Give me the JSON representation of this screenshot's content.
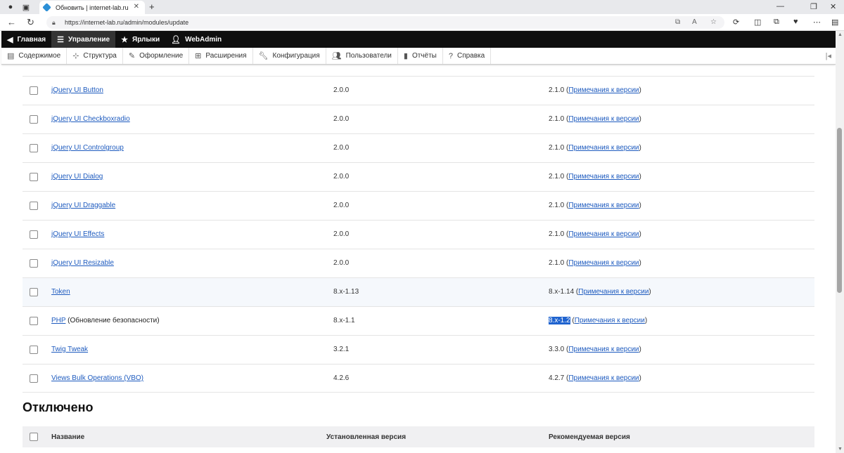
{
  "browser": {
    "tab_title": "Обновить | internet-lab.ru",
    "url": "https://internet-lab.ru/admin/modules/update"
  },
  "toolbar": {
    "items": [
      {
        "label": "Главная",
        "icon": "back-arrow-icon"
      },
      {
        "label": "Управление",
        "icon": "hamburger-icon"
      },
      {
        "label": "Ярлыки",
        "icon": "star-icon"
      },
      {
        "label": "WebAdmin",
        "icon": "user-icon"
      }
    ]
  },
  "tray": {
    "items": [
      {
        "label": "Содержимое",
        "icon": "content-icon"
      },
      {
        "label": "Структура",
        "icon": "structure-icon"
      },
      {
        "label": "Оформление",
        "icon": "appearance-icon"
      },
      {
        "label": "Расширения",
        "icon": "extend-icon"
      },
      {
        "label": "Конфигурация",
        "icon": "wrench-icon"
      },
      {
        "label": "Пользователи",
        "icon": "people-icon"
      },
      {
        "label": "Отчёты",
        "icon": "reports-icon"
      },
      {
        "label": "Справка",
        "icon": "help-icon"
      }
    ]
  },
  "updates": {
    "release_notes_label": "Примечания к версии",
    "rows": [
      {
        "name": "jQuery UI Button",
        "suffix": "",
        "installed": "2.0.0",
        "recommended": "2.1.0"
      },
      {
        "name": "jQuery UI Checkboxradio",
        "suffix": "",
        "installed": "2.0.0",
        "recommended": "2.1.0"
      },
      {
        "name": "jQuery UI Controlgroup",
        "suffix": "",
        "installed": "2.0.0",
        "recommended": "2.1.0"
      },
      {
        "name": "jQuery UI Dialog",
        "suffix": "",
        "installed": "2.0.0",
        "recommended": "2.1.0"
      },
      {
        "name": "jQuery UI Draggable",
        "suffix": "",
        "installed": "2.0.0",
        "recommended": "2.1.0"
      },
      {
        "name": "jQuery UI Effects",
        "suffix": "",
        "installed": "2.0.0",
        "recommended": "2.1.0"
      },
      {
        "name": "jQuery UI Resizable",
        "suffix": "",
        "installed": "2.0.0",
        "recommended": "2.1.0"
      },
      {
        "name": "Token",
        "suffix": "",
        "installed": "8.x-1.13",
        "recommended": "8.x-1.14"
      },
      {
        "name": "PHP",
        "suffix": " (Обновление безопасности)",
        "installed": "8.x-1.1",
        "recommended": "8.x-1.2"
      },
      {
        "name": "Twig Tweak",
        "suffix": "",
        "installed": "3.2.1",
        "recommended": "3.3.0"
      },
      {
        "name": "Views Bulk Operations (VBO)",
        "suffix": "",
        "installed": "4.2.6",
        "recommended": "4.2.7"
      }
    ]
  },
  "disabled": {
    "title": "Отключено",
    "col_name": "Название",
    "col_installed": "Установленная версия",
    "col_recommended": "Рекомендуемая версия"
  }
}
